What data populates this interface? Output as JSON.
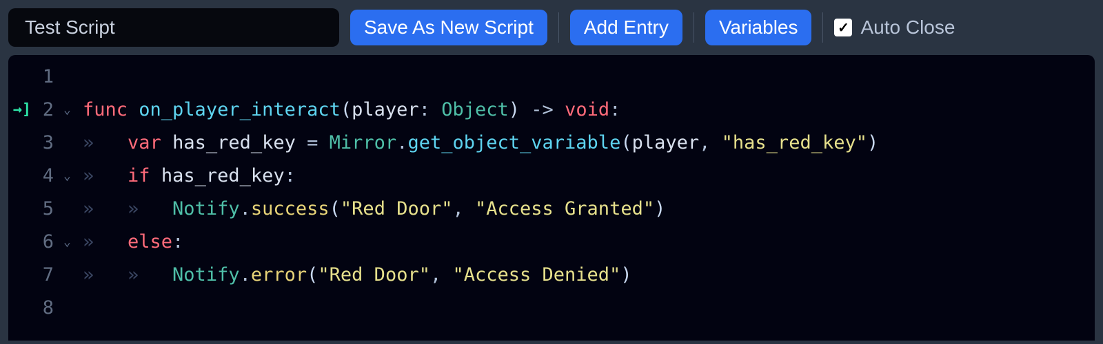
{
  "toolbar": {
    "script_name": "Test Script",
    "save_as_new": "Save As New Script",
    "add_entry": "Add Entry",
    "variables": "Variables",
    "auto_close": "Auto Close",
    "auto_close_checked": true
  },
  "editor": {
    "lines": [
      {
        "num": "1",
        "icon": "",
        "fold": "",
        "tokens": []
      },
      {
        "num": "2",
        "icon": "→]",
        "fold": "⌄",
        "tokens": [
          {
            "c": "kw-red",
            "t": "func "
          },
          {
            "c": "fn-cyan",
            "t": "on_player_interact"
          },
          {
            "c": "paren",
            "t": "("
          },
          {
            "c": "param",
            "t": "player"
          },
          {
            "c": "op",
            "t": ": "
          },
          {
            "c": "type-teal",
            "t": "Object"
          },
          {
            "c": "paren",
            "t": ")"
          },
          {
            "c": "op",
            "t": " -> "
          },
          {
            "c": "kw-red",
            "t": "void"
          },
          {
            "c": "op",
            "t": ":"
          }
        ]
      },
      {
        "num": "3",
        "icon": "",
        "fold": "",
        "tokens": [
          {
            "c": "indent-guide",
            "t": "»   "
          },
          {
            "c": "kw-red",
            "t": "var "
          },
          {
            "c": "param",
            "t": "has_red_key "
          },
          {
            "c": "op",
            "t": "= "
          },
          {
            "c": "type-teal",
            "t": "Mirror"
          },
          {
            "c": "op",
            "t": "."
          },
          {
            "c": "fn-cyan",
            "t": "get_object_variable"
          },
          {
            "c": "paren",
            "t": "("
          },
          {
            "c": "param",
            "t": "player"
          },
          {
            "c": "op",
            "t": ", "
          },
          {
            "c": "string",
            "t": "\"has_red_key\""
          },
          {
            "c": "paren",
            "t": ")"
          }
        ]
      },
      {
        "num": "4",
        "icon": "",
        "fold": "⌄",
        "tokens": [
          {
            "c": "indent-guide",
            "t": "»   "
          },
          {
            "c": "kw-red",
            "t": "if "
          },
          {
            "c": "param",
            "t": "has_red_key"
          },
          {
            "c": "op",
            "t": ":"
          }
        ]
      },
      {
        "num": "5",
        "icon": "",
        "fold": "",
        "tokens": [
          {
            "c": "indent-guide",
            "t": "»   »   "
          },
          {
            "c": "type-teal",
            "t": "Notify"
          },
          {
            "c": "op",
            "t": "."
          },
          {
            "c": "method-yellow",
            "t": "success"
          },
          {
            "c": "paren",
            "t": "("
          },
          {
            "c": "string",
            "t": "\"Red Door\""
          },
          {
            "c": "op",
            "t": ", "
          },
          {
            "c": "string",
            "t": "\"Access Granted\""
          },
          {
            "c": "paren",
            "t": ")"
          }
        ]
      },
      {
        "num": "6",
        "icon": "",
        "fold": "⌄",
        "tokens": [
          {
            "c": "indent-guide",
            "t": "»   "
          },
          {
            "c": "kw-red",
            "t": "else"
          },
          {
            "c": "op",
            "t": ":"
          }
        ]
      },
      {
        "num": "7",
        "icon": "",
        "fold": "",
        "tokens": [
          {
            "c": "indent-guide",
            "t": "»   »   "
          },
          {
            "c": "type-teal",
            "t": "Notify"
          },
          {
            "c": "op",
            "t": "."
          },
          {
            "c": "method-yellow",
            "t": "error"
          },
          {
            "c": "paren",
            "t": "("
          },
          {
            "c": "string",
            "t": "\"Red Door\""
          },
          {
            "c": "op",
            "t": ", "
          },
          {
            "c": "string",
            "t": "\"Access Denied\""
          },
          {
            "c": "paren",
            "t": ")"
          }
        ]
      },
      {
        "num": "8",
        "icon": "",
        "fold": "",
        "tokens": []
      }
    ]
  }
}
